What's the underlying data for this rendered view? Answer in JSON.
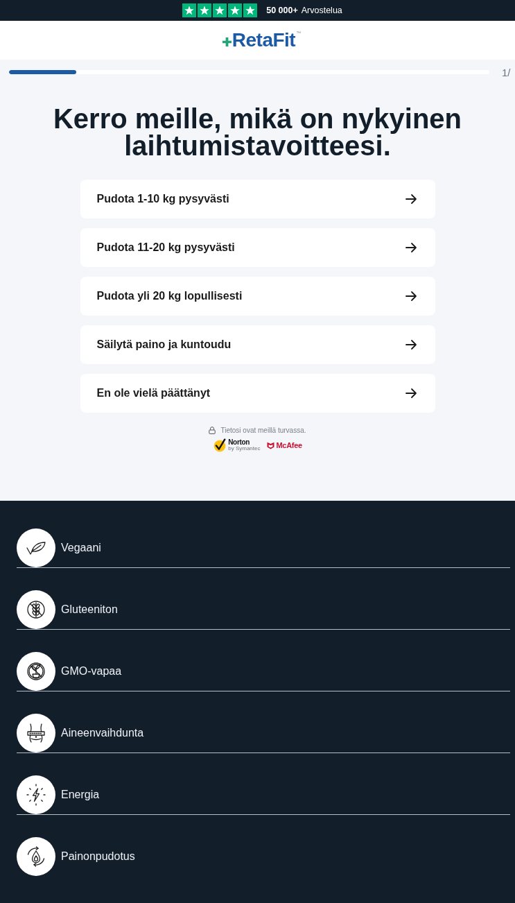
{
  "top_bar": {
    "stars": 5,
    "review_count": "50 000+",
    "review_label": "Arvostelua"
  },
  "header": {
    "logo": "RetaFit",
    "logo_mark": "™"
  },
  "progress": {
    "level": 0.14,
    "step": "1/"
  },
  "question": {
    "title": "Kerro meille, mikä on nykyinen laihtumistavoitteesi."
  },
  "options": [
    {
      "label": "Pudota 1-10 kg pysyvästi"
    },
    {
      "label": "Pudota 11-20 kg pysyvästi"
    },
    {
      "label": "Pudota yli 20 kg lopullisesti"
    },
    {
      "label": "Säilytä paino ja kuntoudu"
    },
    {
      "label": "En ole vielä päättänyt"
    }
  ],
  "security": {
    "note": "Tietosi ovat meillä turvassa.",
    "badges": [
      {
        "kind": "norton",
        "name": "Norton",
        "caption": "by Symantec"
      },
      {
        "kind": "mcafee",
        "name": "McAfee"
      }
    ]
  },
  "features": [
    {
      "label": "Vegaani"
    },
    {
      "label": "Gluteeniton"
    },
    {
      "label": "GMO-vapaa"
    },
    {
      "label": "Aineenvaihdunta"
    },
    {
      "label": "Energia"
    },
    {
      "label": "Painonpudotus"
    }
  ]
}
